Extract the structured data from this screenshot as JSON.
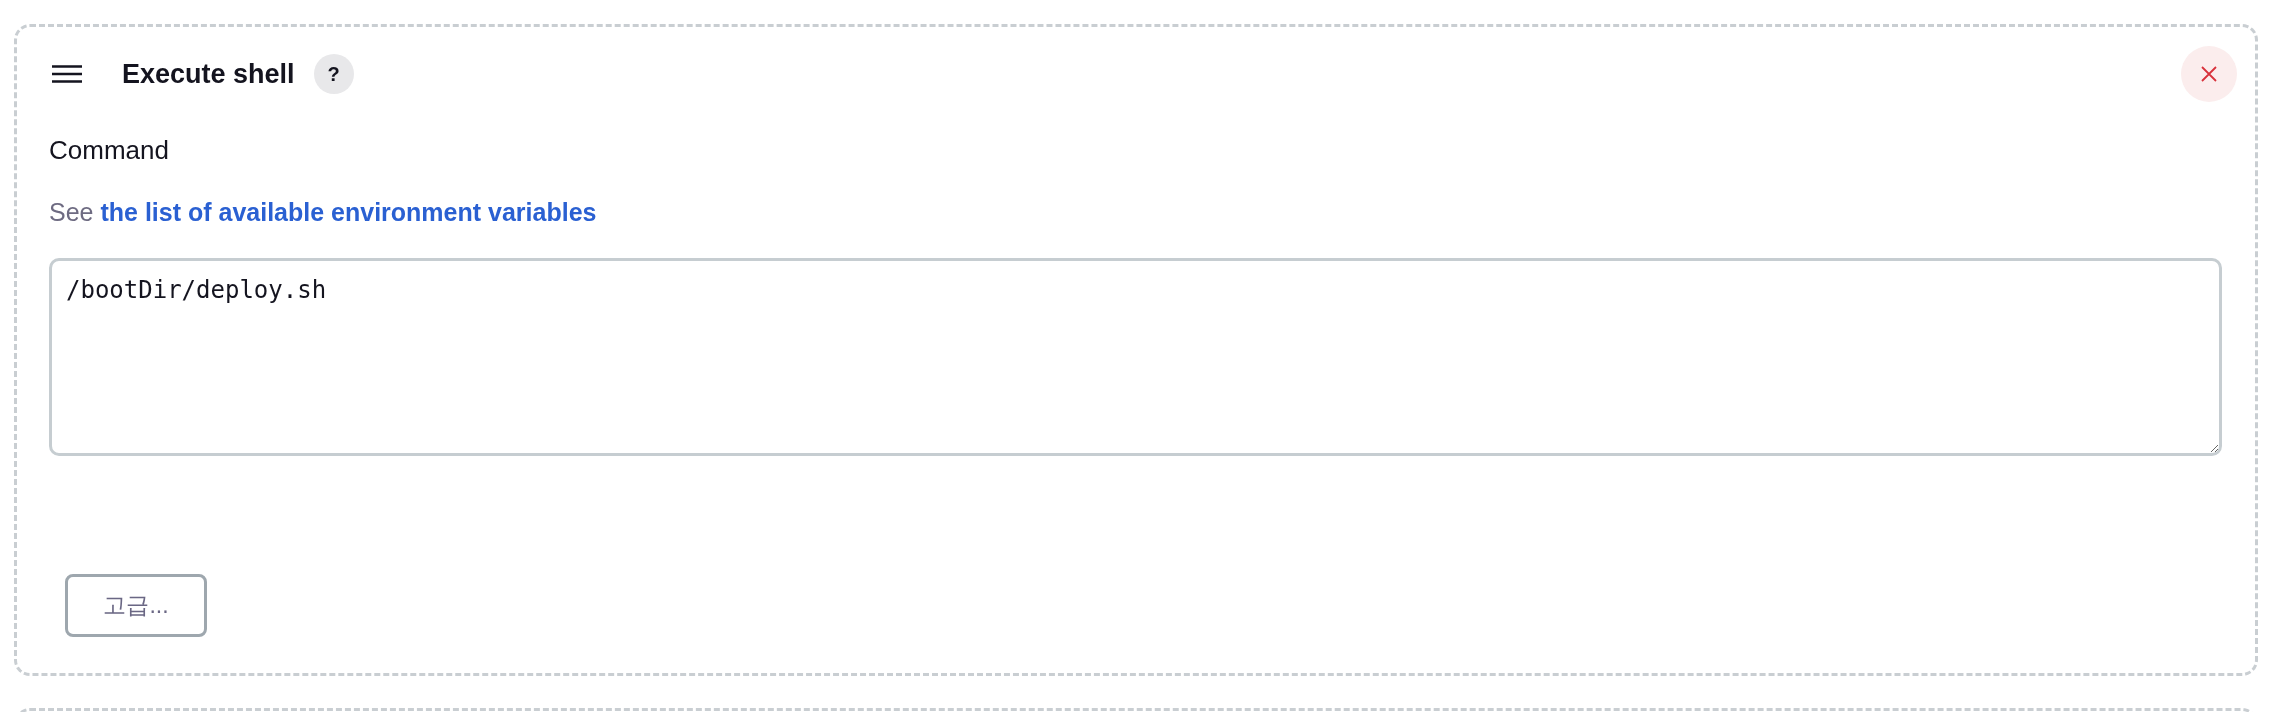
{
  "build_step": {
    "title": "Execute shell",
    "help_button": "?"
  },
  "command": {
    "label": "Command",
    "hint": {
      "prefix": "See",
      "link": "the list of available environment variables"
    },
    "value": "/bootDir/deploy.sh"
  },
  "advanced_button": "고급..."
}
